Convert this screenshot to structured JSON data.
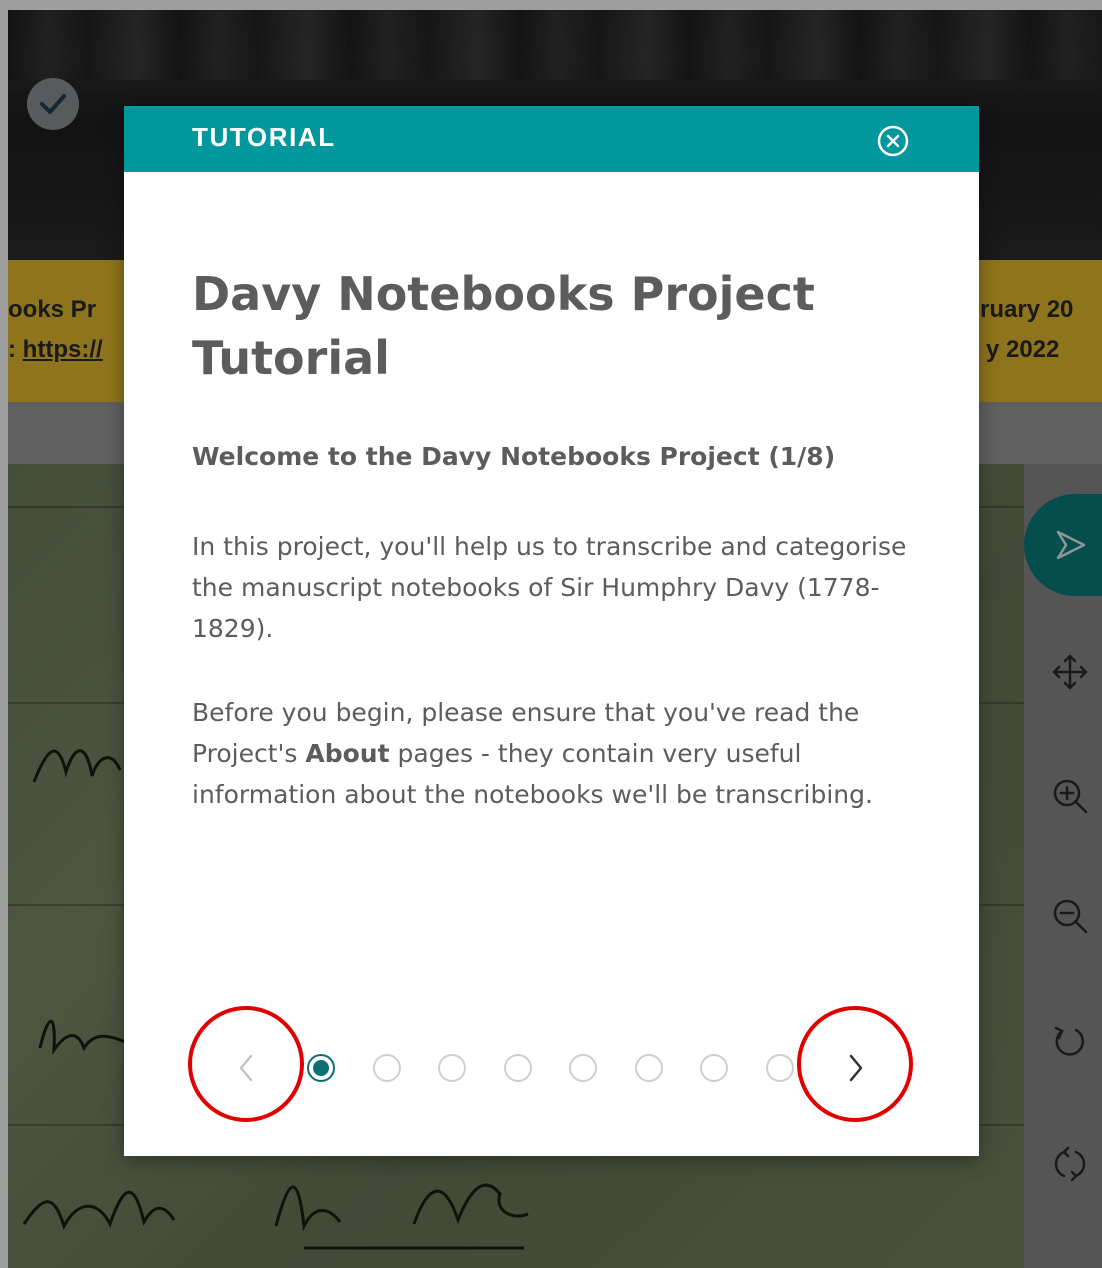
{
  "background": {
    "banner_left_line1": "ooks Pr",
    "banner_left_line2_prefix": ":",
    "banner_left_link": "https://",
    "banner_right_line1": "ruary 20",
    "banner_right_line2": "y 2022",
    "status_icon": "check-circle-icon",
    "toolbar_icons": [
      "pointer-icon",
      "move-icon",
      "zoom-in-icon",
      "zoom-out-icon",
      "rotate-icon",
      "reset-icon"
    ]
  },
  "modal": {
    "title": "TUTORIAL",
    "heading": "Davy Notebooks Project Tutorial",
    "subheading": "Welcome to the Davy Notebooks Project (1/8)",
    "paragraph1": "In this project, you'll help us to transcribe and categorise the manuscript notebooks of Sir Humphry Davy (1778-1829).",
    "paragraph2_before": "Before you begin, please ensure that you've read the Project's ",
    "paragraph2_bold": "About",
    "paragraph2_after": " pages - they contain very useful information about the notebooks we'll be transcribing.",
    "step_current": 1,
    "step_total": 8
  },
  "colors": {
    "header_teal": "#00979d",
    "active_dot": "#0b6f74",
    "banner_yellow": "#e6bb2e",
    "annotation_red": "#e00000"
  }
}
